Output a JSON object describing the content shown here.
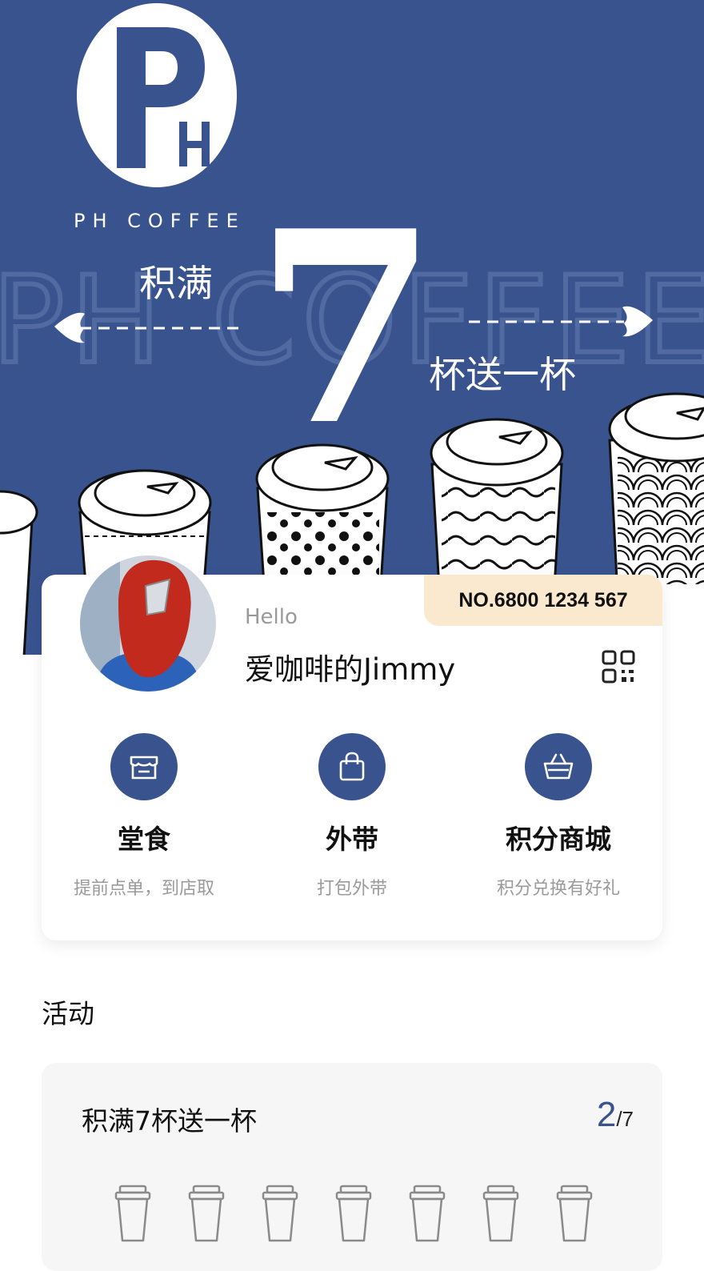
{
  "hero": {
    "brand": "PH COFFEE",
    "watermark": "PH COFFEE",
    "slogan_left": "积满",
    "big_number": "7",
    "slogan_right": "杯送一杯",
    "background_color": "#39538f"
  },
  "profile": {
    "member_no": "NO.6800 1234 567",
    "greeting": "Hello",
    "username": "爱咖啡的Jimmy",
    "qr_icon": "qr-code-icon",
    "avatar": "avatar-image"
  },
  "features": [
    {
      "icon": "store-icon",
      "title": "堂食",
      "subtitle": "提前点单，到店取"
    },
    {
      "icon": "shopping-bag-icon",
      "title": "外带",
      "subtitle": "打包外带"
    },
    {
      "icon": "basket-icon",
      "title": "积分商城",
      "subtitle": "积分兑换有好礼"
    }
  ],
  "activity_section": {
    "title": "活动",
    "card": {
      "title": "积满7杯送一杯",
      "current": "2",
      "total": "/7",
      "cups_total": 7
    }
  },
  "colors": {
    "accent": "#39538f",
    "member_badge": "#fbe9cf",
    "muted_text": "#9a9a9a"
  }
}
